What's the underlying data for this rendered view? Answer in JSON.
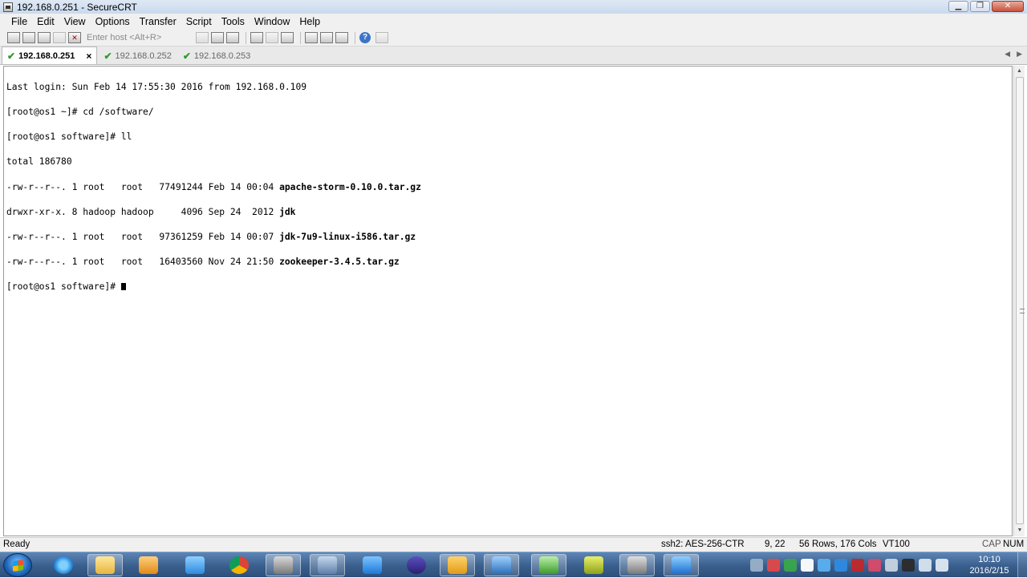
{
  "window": {
    "title": "192.168.0.251 - SecureCRT",
    "minimize_glyph": "▁",
    "maximize_glyph": "❐",
    "close_glyph": "✕"
  },
  "menu": [
    "File",
    "Edit",
    "View",
    "Options",
    "Transfer",
    "Script",
    "Tools",
    "Window",
    "Help"
  ],
  "toolbar": {
    "host_placeholder": "Enter host <Alt+R>",
    "icons": [
      "connect-icon",
      "quick-connect-icon",
      "connect-in-tab-icon",
      "reconnect-icon",
      "disconnect-icon",
      "copy-icon",
      "paste-icon",
      "find-icon",
      "print-icon",
      "print-selection-icon",
      "print-setup-icon",
      "session-options-icon",
      "global-options-icon",
      "keymap-icon",
      "help-icon",
      "sftp-icon"
    ]
  },
  "tabs": [
    {
      "label": "192.168.0.251",
      "active": true,
      "close": "×"
    },
    {
      "label": "192.168.0.252",
      "active": false
    },
    {
      "label": "192.168.0.253",
      "active": false
    }
  ],
  "tab_nav": {
    "left": "◀",
    "right": "▶"
  },
  "terminal": {
    "line1": "Last login: Sun Feb 14 17:55:30 2016 from 192.168.0.109",
    "line2": "[root@os1 ~]# cd /software/",
    "line3": "[root@os1 software]# ll",
    "line4": "total 186780",
    "files": [
      {
        "meta": "-rw-r--r--. 1 root   root   77491244 Feb 14 00:04 ",
        "name": "apache-storm-0.10.0.tar.gz"
      },
      {
        "meta": "drwxr-xr-x. 8 hadoop hadoop     4096 Sep 24  2012 ",
        "name": "jdk"
      },
      {
        "meta": "-rw-r--r--. 1 root   root   97361259 Feb 14 00:07 ",
        "name": "jdk-7u9-linux-i586.tar.gz"
      },
      {
        "meta": "-rw-r--r--. 1 root   root   16403560 Nov 24 21:50 ",
        "name": "zookeeper-3.4.5.tar.gz"
      }
    ],
    "prompt": "[root@os1 software]# "
  },
  "status": {
    "ready": "Ready",
    "cipher": "ssh2: AES-256-CTR",
    "cursor_pos": "9,  22",
    "size": "56 Rows, 176 Cols",
    "emulation": "VT100",
    "caps": "CAP",
    "num": "NUM"
  },
  "taskbar": {
    "apps": [
      "internet-explorer",
      "file-explorer",
      "media-player",
      "baidu-netdisk",
      "chrome",
      "securecrt-launcher",
      "network-manager",
      "feather-app",
      "eclipse",
      "sogou-app",
      "virtualbox",
      "putty-app",
      "mybase-app",
      "securecrt",
      "qq"
    ],
    "clock_time": "10:10",
    "clock_date": "2016/2/15"
  },
  "colors": {
    "taskbar": "#3a5f8d",
    "terminal_bg": "#ffffff",
    "terminal_fg": "#000000",
    "tab_check": "#2d9b2d"
  }
}
